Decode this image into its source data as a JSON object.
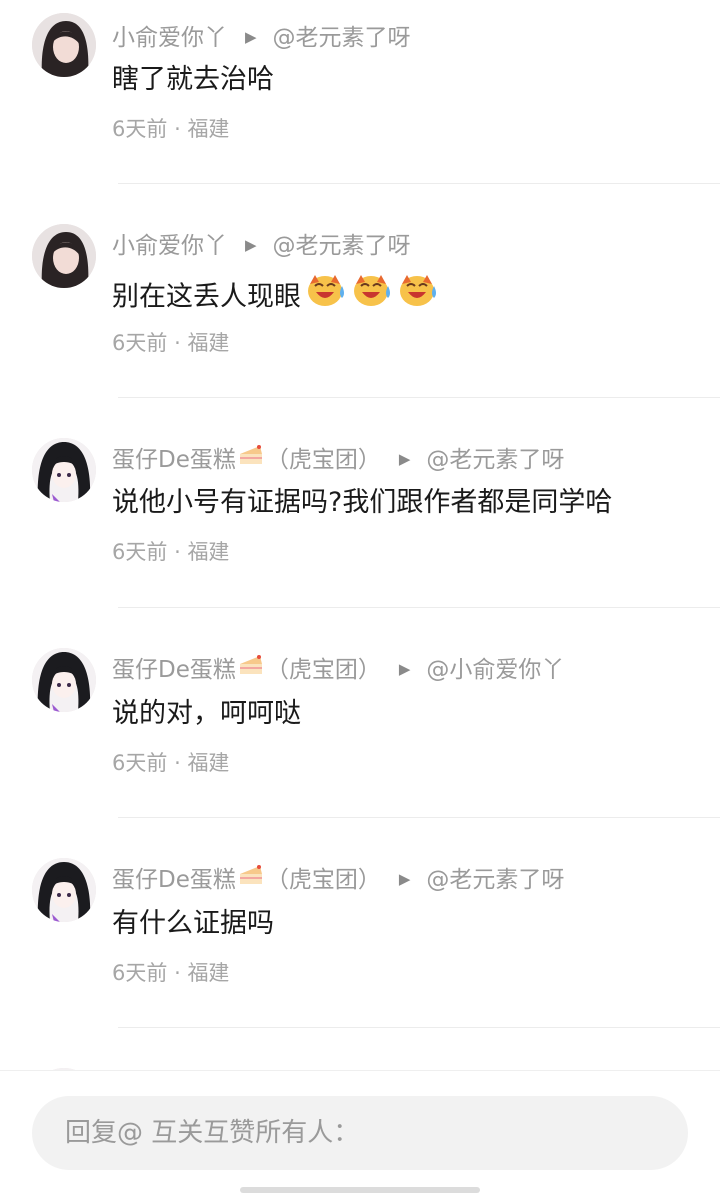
{
  "comments": [
    {
      "user": "小俞爱你丫",
      "reply_to": "@老元素了呀",
      "text": "瞎了就去治哈",
      "time": "6天前",
      "location": "福建"
    },
    {
      "user": "小俞爱你丫",
      "reply_to": "@老元素了呀",
      "text": "别在这丢人现眼",
      "emojis": [
        "laugh-cry-emoji",
        "laugh-cry-emoji",
        "laugh-cry-emoji"
      ],
      "time": "6天前",
      "location": "福建"
    },
    {
      "user": "蛋仔De蛋糕",
      "user_suffix": "（虎宝团）",
      "reply_to": "@老元素了呀",
      "text": "说他小号有证据吗?我们跟作者都是同学哈",
      "time": "6天前",
      "location": "福建"
    },
    {
      "user": "蛋仔De蛋糕",
      "user_suffix": "（虎宝团）",
      "reply_to": "@小俞爱你丫",
      "text": "说的对，呵呵哒",
      "time": "6天前",
      "location": "福建"
    },
    {
      "user": "蛋仔De蛋糕",
      "user_suffix": "（虎宝团）",
      "reply_to": "@老元素了呀",
      "text": "有什么证据吗",
      "time": "6天前",
      "location": "福建"
    }
  ],
  "separator": "·",
  "reply_box": {
    "placeholder": "回复@ 互关互赞所有人："
  },
  "icons": {
    "reply_arrow": "play-arrow-icon",
    "cake": "cake-icon"
  },
  "colors": {
    "text": "#1a1a1a",
    "meta": "#9a9a9a",
    "time": "#a6a6a6",
    "input_bg": "#f2f2f2",
    "divider": "#ececec"
  }
}
